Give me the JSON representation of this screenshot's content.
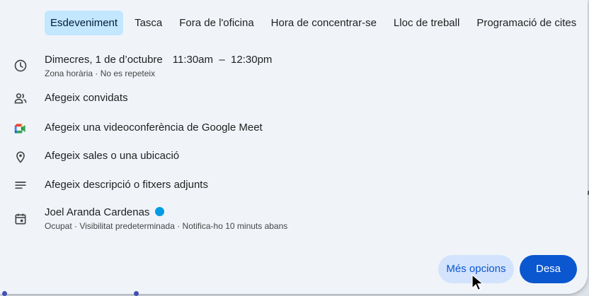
{
  "tabs": [
    "Esdeveniment",
    "Tasca",
    "Fora de l'oficina",
    "Hora de concentrar-se",
    "Lloc de treball",
    "Programació de cites"
  ],
  "event": {
    "date": "Dimecres, 1 de d’octubre",
    "start": "11:30am",
    "separator": "–",
    "end": "12:30pm",
    "details": "Zona horària · No es repeteix"
  },
  "guests_label": "Afegeix convidats",
  "meet_label": "Afegeix una videoconferència de Google Meet",
  "location_label": "Afegeix sales o una ubicació",
  "description_label": "Afegeix descripció o fitxers adjunts",
  "calendar": {
    "owner": "Joel Aranda Cardenas",
    "details": "Ocupat · Visibilitat predeterminada · Notifica-ho 10 minuts abans",
    "color": "#039be5"
  },
  "buttons": {
    "more": "Més opcions",
    "save": "Desa"
  },
  "colors": {
    "accent": "#0b57d0",
    "tab_active_bg": "#c2e7ff",
    "dialog_bg": "#f0f4f9"
  },
  "icons": [
    "clock-icon",
    "people-icon",
    "google-meet-icon",
    "location-pin-icon",
    "notes-icon",
    "calendar-icon"
  ]
}
